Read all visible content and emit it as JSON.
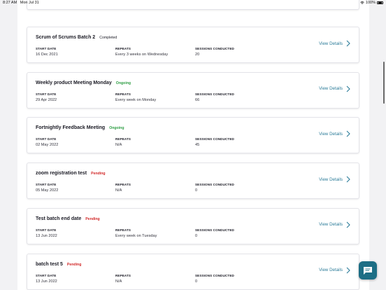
{
  "status_bar": {
    "time": "8:27 AM",
    "date": "Mon Jul 31",
    "battery": "100%"
  },
  "labels": {
    "start_date": "START DATE",
    "repeats": "REPEATS",
    "sessions": "SESSIONS CONDUCTED",
    "view_details": "View Details"
  },
  "batches": [
    {
      "title": "",
      "status": "",
      "status_type": "",
      "start_date": "20 Oct 2021",
      "repeats": "Every week on Wednesday",
      "sessions": "13"
    },
    {
      "title": "Scrum of Scrums Batch 2",
      "status": "Completed",
      "status_type": "completed",
      "start_date": "16 Dec 2021",
      "repeats": "Every 3 weeks on Wednesday",
      "sessions": "20"
    },
    {
      "title": "Weekly product Meeting Monday",
      "status": "Ongoing",
      "status_type": "ongoing",
      "start_date": "29 Apr 2022",
      "repeats": "Every week on Monday",
      "sessions": "66"
    },
    {
      "title": "Fortnightly Feedback Meeting",
      "status": "Ongoing",
      "status_type": "ongoing",
      "start_date": "02 May 2022",
      "repeats": "N/A",
      "sessions": "45"
    },
    {
      "title": "zoom registration test",
      "status": "Pending",
      "status_type": "pending",
      "start_date": "05 May 2022",
      "repeats": "N/A",
      "sessions": "0"
    },
    {
      "title": "Test batch end date",
      "status": "Pending",
      "status_type": "pending",
      "start_date": "13 Jun 2022",
      "repeats": "Every week on Tuesday",
      "sessions": "0"
    },
    {
      "title": "batch test 5",
      "status": "Pending",
      "status_type": "pending",
      "start_date": "13 Jun 2022",
      "repeats": "N/A",
      "sessions": "0"
    }
  ],
  "icons": {
    "chevron": "chevron-right-icon",
    "chat": "chat-bubble-icon",
    "wifi": "wifi-icon",
    "battery": "battery-icon"
  },
  "colors": {
    "link": "#2e7d9a",
    "ongoing": "#2e9e44",
    "pending": "#d22a2a",
    "fab": "#1d6e85"
  }
}
